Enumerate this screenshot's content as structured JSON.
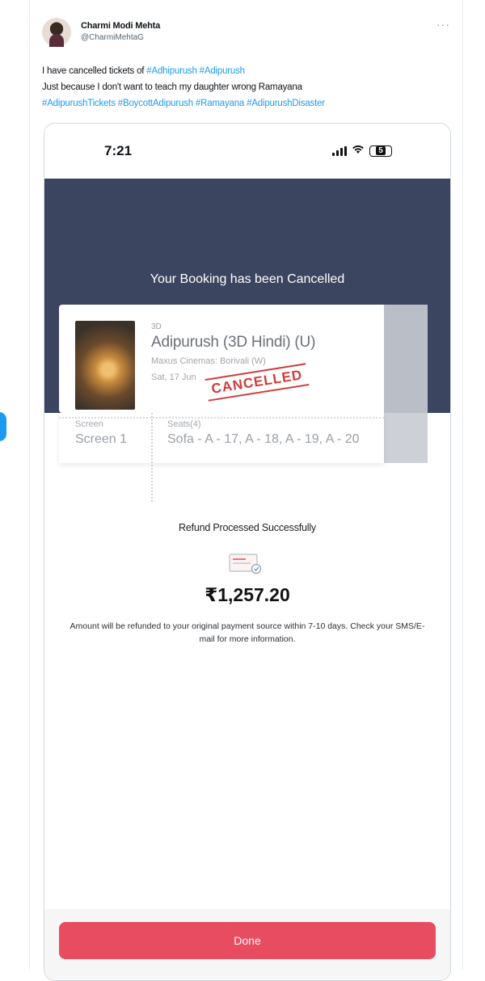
{
  "tweet": {
    "author_name": "Charmi Modi Mehta",
    "author_handle": "@CharmiMehtaG",
    "more_label": "···",
    "text_line1": "I have cancelled tickets of ",
    "tag1": "#Adhipurush",
    "tag2": "#Adipurush",
    "text_line2": "Just because I don't want to teach my daughter wrong Ramayana",
    "tags_line3": [
      "#AdipurushTickets",
      "#BoycottAdipurush",
      "#Ramayana",
      "#AdipurushDisaster"
    ]
  },
  "phone": {
    "time": "7:21",
    "battery": "5"
  },
  "booking": {
    "banner_title": "Your Booking has been Cancelled",
    "format": "3D",
    "movie_title": "Adipurush (3D Hindi) (U)",
    "venue": "Maxus Cinemas: Borivali (W)",
    "date": "Sat, 17 Jun",
    "stamp": "CANCELLED",
    "screen_label": "Screen",
    "screen_value": "Screen 1",
    "seats_label": "Seats(4)",
    "seats_value": "Sofa - A - 17, A - 18, A - 19, A - 20"
  },
  "refund": {
    "title": "Refund Processed Successfully",
    "amount": "₹1,257.20",
    "note": "Amount will be refunded to your original payment source within 7-10 days. Check your SMS/E-mail for more information."
  },
  "actions": {
    "done_label": "Done"
  },
  "colors": {
    "link": "#1d9bf0",
    "banner": "#3c4560",
    "stamp": "#d23b3b",
    "done_button": "#e74c60"
  }
}
